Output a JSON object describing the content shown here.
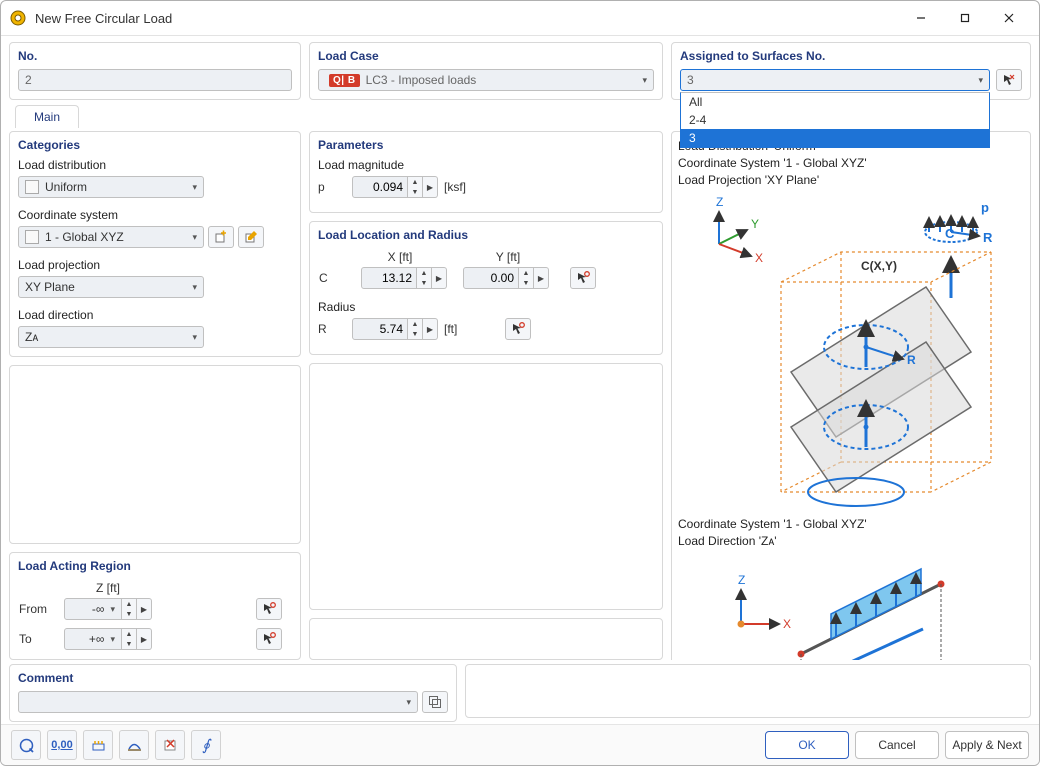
{
  "window": {
    "title": "New Free Circular Load"
  },
  "top": {
    "no": {
      "label": "No.",
      "value": "2"
    },
    "loadCase": {
      "label": "Load Case",
      "badge": "Q| B",
      "value": "LC3 - Imposed loads"
    },
    "assigned": {
      "label": "Assigned to Surfaces No.",
      "value": "3",
      "options": [
        "All",
        "2-4",
        "3"
      ],
      "selected": "3"
    }
  },
  "tabs": {
    "main": "Main"
  },
  "categories": {
    "title": "Categories",
    "loadDistribution": {
      "label": "Load distribution",
      "value": "Uniform"
    },
    "coordinateSystem": {
      "label": "Coordinate system",
      "value": "1 - Global XYZ"
    },
    "loadProjection": {
      "label": "Load projection",
      "value": "XY Plane"
    },
    "loadDirection": {
      "label": "Load direction",
      "value": "Zᴀ"
    }
  },
  "parameters": {
    "title": "Parameters",
    "magnitude": {
      "label": "Load magnitude",
      "symbol": "p",
      "value": "0.094",
      "unit": "[ksf]"
    }
  },
  "location": {
    "title": "Load Location and Radius",
    "xHeader": "X [ft]",
    "yHeader": "Y [ft]",
    "rowC": {
      "label": "C",
      "x": "13.12",
      "y": "0.00"
    },
    "radius": {
      "label": "Radius",
      "symbol": "R",
      "value": "5.74",
      "unit": "[ft]"
    }
  },
  "actingRegion": {
    "title": "Load Acting Region",
    "zHeader": "Z [ft]",
    "from": {
      "label": "From",
      "value": "-∞"
    },
    "to": {
      "label": "To",
      "value": "+∞"
    }
  },
  "comment": {
    "title": "Comment",
    "value": ""
  },
  "right": {
    "line1": "Load Distribution 'Uniform'",
    "line2": "Coordinate System '1 - Global XYZ'",
    "line3": "Load Projection 'XY Plane'",
    "line4": "Coordinate System '1 - Global XYZ'",
    "line5": "Load Direction 'Zᴀ'"
  },
  "footer": {
    "ok": "OK",
    "cancel": "Cancel",
    "applyNext": "Apply & Next"
  }
}
